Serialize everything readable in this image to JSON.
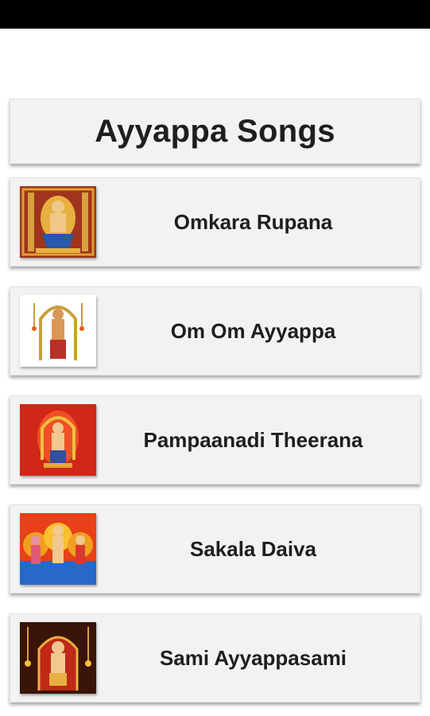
{
  "header": {
    "title": "Ayyappa Songs"
  },
  "songs": [
    {
      "label": "Omkara Rupana",
      "image": "ayyappa-deity-gold-frame"
    },
    {
      "label": "Om Om Ayyappa",
      "image": "ayyappa-idol-white-background"
    },
    {
      "label": "Pampaanadi Theerana",
      "image": "ayyappa-deity-red-background"
    },
    {
      "label": "Sakala Daiva",
      "image": "three-deities-colorful"
    },
    {
      "label": "Sami Ayyappasami",
      "image": "ayyappa-temple-lamps"
    }
  ],
  "colors": {
    "card_bg": "#f2f2f2",
    "status_bar": "#000000",
    "text": "#1e1e1e"
  }
}
